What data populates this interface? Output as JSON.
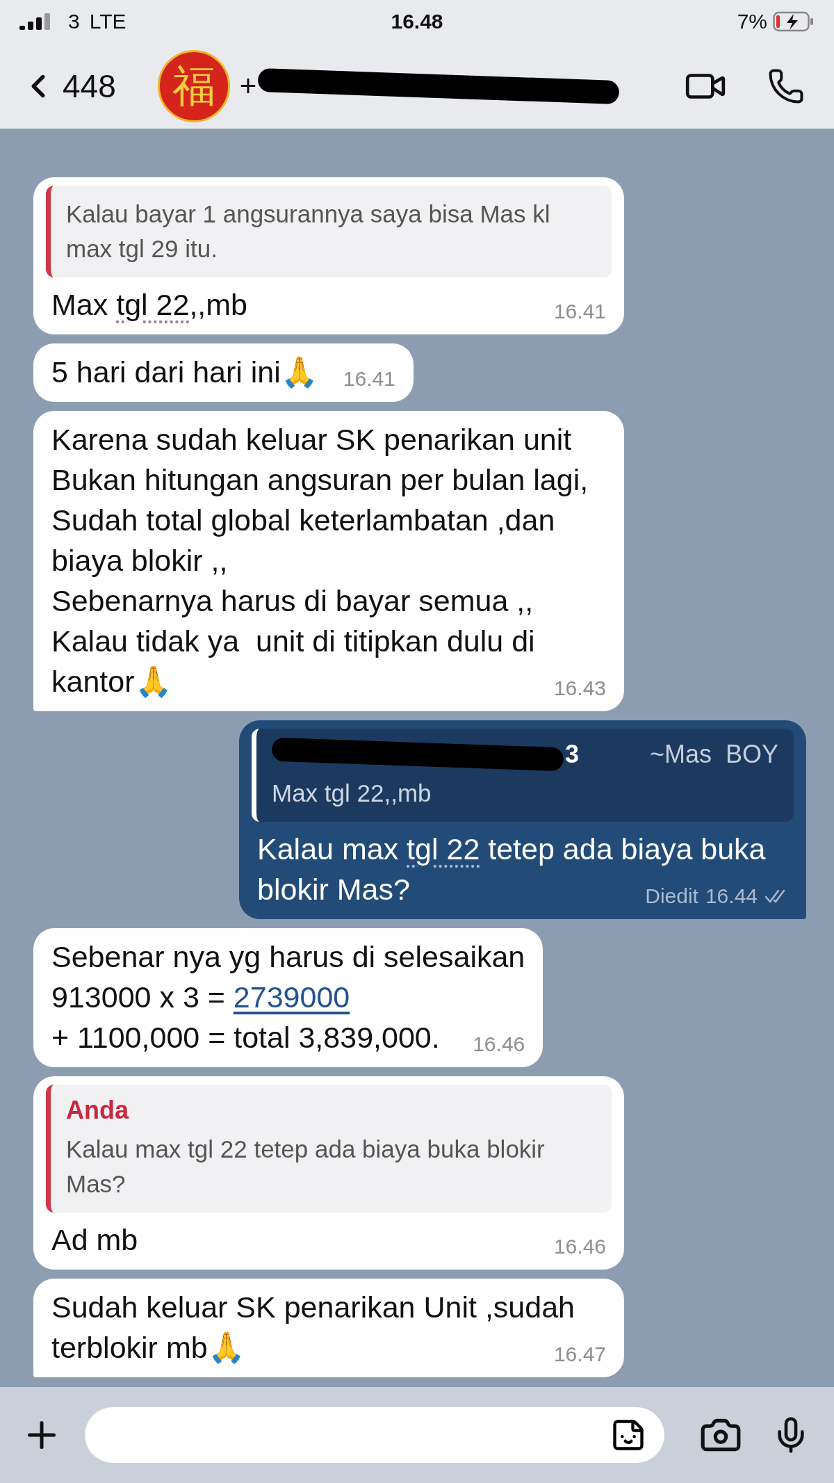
{
  "status_bar": {
    "carrier": "3",
    "network": "LTE",
    "time": "16.48",
    "battery": "7%",
    "charging": true
  },
  "header": {
    "back_count": "448",
    "avatar_glyph": "福",
    "name_visible": "+",
    "name_redacted": true
  },
  "messages": [
    {
      "outgoing": false,
      "tail": false,
      "quote": {
        "text": "Kalau bayar 1 angsurannya saya bisa Mas kl max tgl 29 itu."
      },
      "parts": [
        {
          "kind": "plain",
          "text": "Max "
        },
        {
          "kind": "underlined",
          "text": "tgl 22"
        },
        {
          "kind": "plain",
          "text": ",,mb"
        }
      ],
      "time": "16.41"
    },
    {
      "outgoing": false,
      "tail": false,
      "parts": [
        {
          "kind": "plain",
          "text": "5 hari dari hari ini🙏"
        }
      ],
      "time": "16.41"
    },
    {
      "outgoing": false,
      "tail": true,
      "parts": [
        {
          "kind": "plain",
          "text": "Karena sudah keluar SK penarikan unit\nBukan hitungan angsuran per bulan lagi,\nSudah total global keterlambatan ,dan biaya blokir ,,\nSebenarnya harus di bayar semua ,,\nKalau tidak ya  unit di titipkan dulu di kantor🙏"
        }
      ],
      "time": "16.43"
    },
    {
      "outgoing": true,
      "tail": true,
      "quote": {
        "sender": "3",
        "redacted": true,
        "note": "~Mas  BOY",
        "text": "Max tgl 22,,mb"
      },
      "parts": [
        {
          "kind": "plain",
          "text": "Kalau max "
        },
        {
          "kind": "underlined",
          "text": "tgl 22"
        },
        {
          "kind": "plain",
          "text": " tetep ada biaya buka blokir Mas?"
        }
      ],
      "edited": "Diedit",
      "time": "16.44",
      "read": true
    },
    {
      "outgoing": false,
      "tail": false,
      "parts": [
        {
          "kind": "plain",
          "text": "Sebenar nya yg harus di selesaikan\n913000 x 3 = "
        },
        {
          "kind": "link",
          "text": "2739000"
        },
        {
          "kind": "plain",
          "text": "\n+ 1100,000 = total 3,839,000."
        }
      ],
      "time": "16.46"
    },
    {
      "outgoing": false,
      "tail": false,
      "quote": {
        "sender": "Anda",
        "text": "Kalau max tgl 22 tetep ada biaya buka blokir Mas?"
      },
      "parts": [
        {
          "kind": "plain",
          "text": "Ad mb"
        }
      ],
      "time": "16.46"
    },
    {
      "outgoing": false,
      "tail": true,
      "parts": [
        {
          "kind": "plain",
          "text": "Sudah keluar SK penarikan Unit ,sudah terblokir mb🙏"
        }
      ],
      "time": "16.47"
    }
  ]
}
